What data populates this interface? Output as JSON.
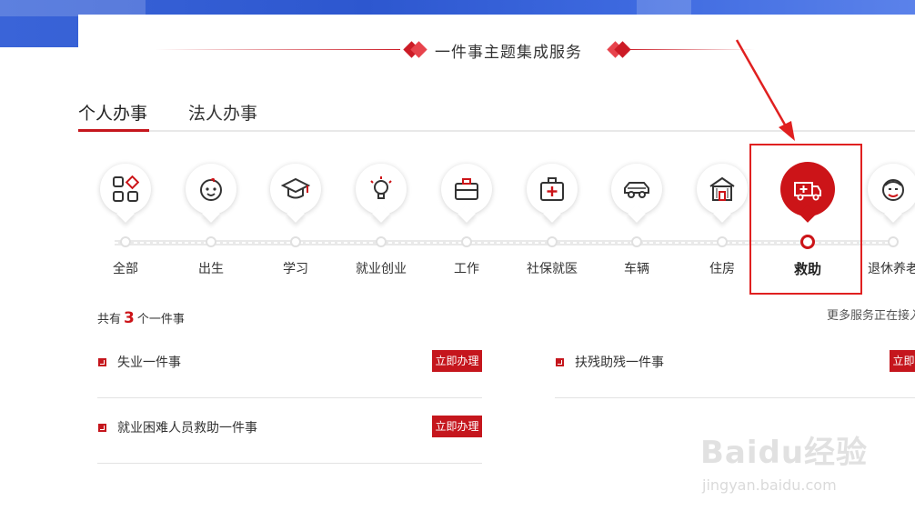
{
  "section_title": "一件事主题集成服务",
  "tabs": [
    {
      "label": "个人办事",
      "active": true
    },
    {
      "label": "法人办事",
      "active": false
    }
  ],
  "categories": [
    {
      "label": "全部",
      "icon": "grid-icon"
    },
    {
      "label": "出生",
      "icon": "baby-icon"
    },
    {
      "label": "学习",
      "icon": "graduation-cap-icon"
    },
    {
      "label": "就业创业",
      "icon": "lightbulb-icon"
    },
    {
      "label": "工作",
      "icon": "briefcase-icon"
    },
    {
      "label": "社保就医",
      "icon": "medical-kit-icon"
    },
    {
      "label": "车辆",
      "icon": "car-icon"
    },
    {
      "label": "住房",
      "icon": "house-icon"
    },
    {
      "label": "救助",
      "icon": "ambulance-icon",
      "active": true
    },
    {
      "label": "退休养老",
      "icon": "elderly-icon"
    }
  ],
  "summary": {
    "prefix": "共有",
    "count": "3",
    "suffix": "个一件事"
  },
  "more_services": "更多服务正在接入",
  "services": [
    {
      "name": "失业一件事",
      "button": "立即办理"
    },
    {
      "name": "扶残助残一件事",
      "button": "立即办理"
    },
    {
      "name": "就业困难人员救助一件事",
      "button": "立即办理"
    }
  ],
  "colors": {
    "accent": "#c5161d",
    "annotation": "#e02020",
    "banner": "#2d57cf"
  },
  "watermark": {
    "brand": "Baidu经验",
    "url": "jingyan.baidu.com"
  }
}
